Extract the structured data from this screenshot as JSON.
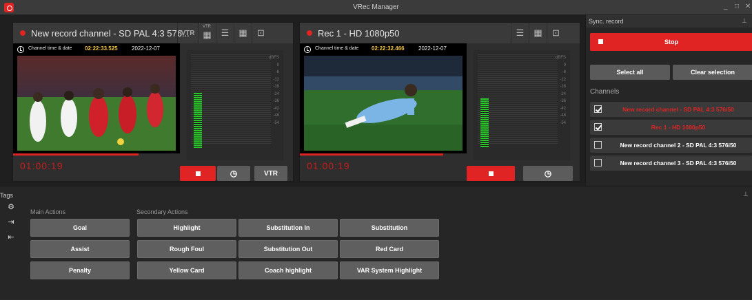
{
  "window": {
    "title": "VRec Manager",
    "min": "_",
    "max": "□",
    "close": "✕"
  },
  "panel1": {
    "name": "New record channel - SD PAL 4:3 576...",
    "vtr_label": "VTR",
    "vtr_mini": "VTR",
    "time_label": "Channel time & date",
    "time": "02:22:33.525",
    "date": "2022-12-07",
    "timecode": "01:00:19",
    "dbfs": [
      "dBFS",
      "0",
      "-6",
      "-12",
      "-18",
      "-24",
      "-36",
      "-42",
      "-48",
      "-54"
    ],
    "btn_vtr": "VTR",
    "progress": 0.75
  },
  "panel2": {
    "name": "Rec 1 - HD 1080p50",
    "time_label": "Channel time & date",
    "time": "02:22:32.466",
    "date": "2022-12-07",
    "timecode": "01:00:19",
    "dbfs": [
      "dBFS",
      "0",
      "-6",
      "-12",
      "-18",
      "-24",
      "-36",
      "-42",
      "-48",
      "-54"
    ],
    "progress": 0.86
  },
  "sync": {
    "title": "Sync. record",
    "stop": "Stop",
    "select_all": "Select all",
    "clear_selection": "Clear selection",
    "channels_label": "Channels",
    "channels": [
      {
        "label": "New record channel - SD PAL 4:3 576i50",
        "checked": true,
        "color": "#e02424"
      },
      {
        "label": "Rec 1 - HD 1080p50",
        "checked": true,
        "color": "#e02424"
      },
      {
        "label": "New record channel 2 - SD PAL 4:3 576i50",
        "checked": false,
        "color": "#ffffff"
      },
      {
        "label": "New record channel 3 - SD PAL 4:3 576i50",
        "checked": false,
        "color": "#ffffff"
      }
    ]
  },
  "tags": {
    "title": "Tags",
    "main_label": "Main Actions",
    "secondary_label": "Secondary Actions",
    "main": [
      "Goal",
      "Assist",
      "Penalty"
    ],
    "secondary": [
      [
        "Highlight",
        "Substitution In",
        "Substitution"
      ],
      [
        "Rough Foul",
        "Substitution Out",
        "Red Card"
      ],
      [
        "Yellow Card",
        "Coach highlight",
        "VAR System Highlight"
      ]
    ]
  },
  "colors": {
    "accent": "#e02424",
    "time": "#f6c642",
    "meter": "#29c729"
  }
}
